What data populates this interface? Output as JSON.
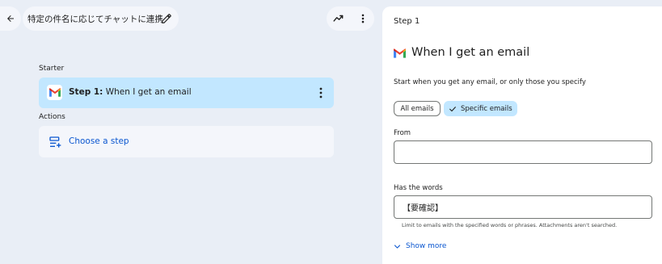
{
  "header": {
    "title": "特定の件名に応じてチャットに連携"
  },
  "flow": {
    "starter_label": "Starter",
    "step": {
      "prefix": "Step 1:",
      "text": "When I get an email"
    },
    "actions_label": "Actions",
    "choose_step_label": "Choose a step"
  },
  "panel": {
    "step_label": "Step 1",
    "trigger_title": "When I get an email",
    "description": "Start when you get any email, or only those you specify",
    "chips": {
      "all": "All emails",
      "specific": "Specific emails"
    },
    "from": {
      "label": "From",
      "value": ""
    },
    "words": {
      "label": "Has the words",
      "value": "【要確認】"
    },
    "hint": "Limit to emails with the specified words or phrases. Attachments aren't searched.",
    "show_more": "Show more"
  },
  "colors": {
    "accent": "#0b57d0",
    "selected_bg": "#c2e7ff",
    "canvas_bg": "#e9eef6"
  }
}
